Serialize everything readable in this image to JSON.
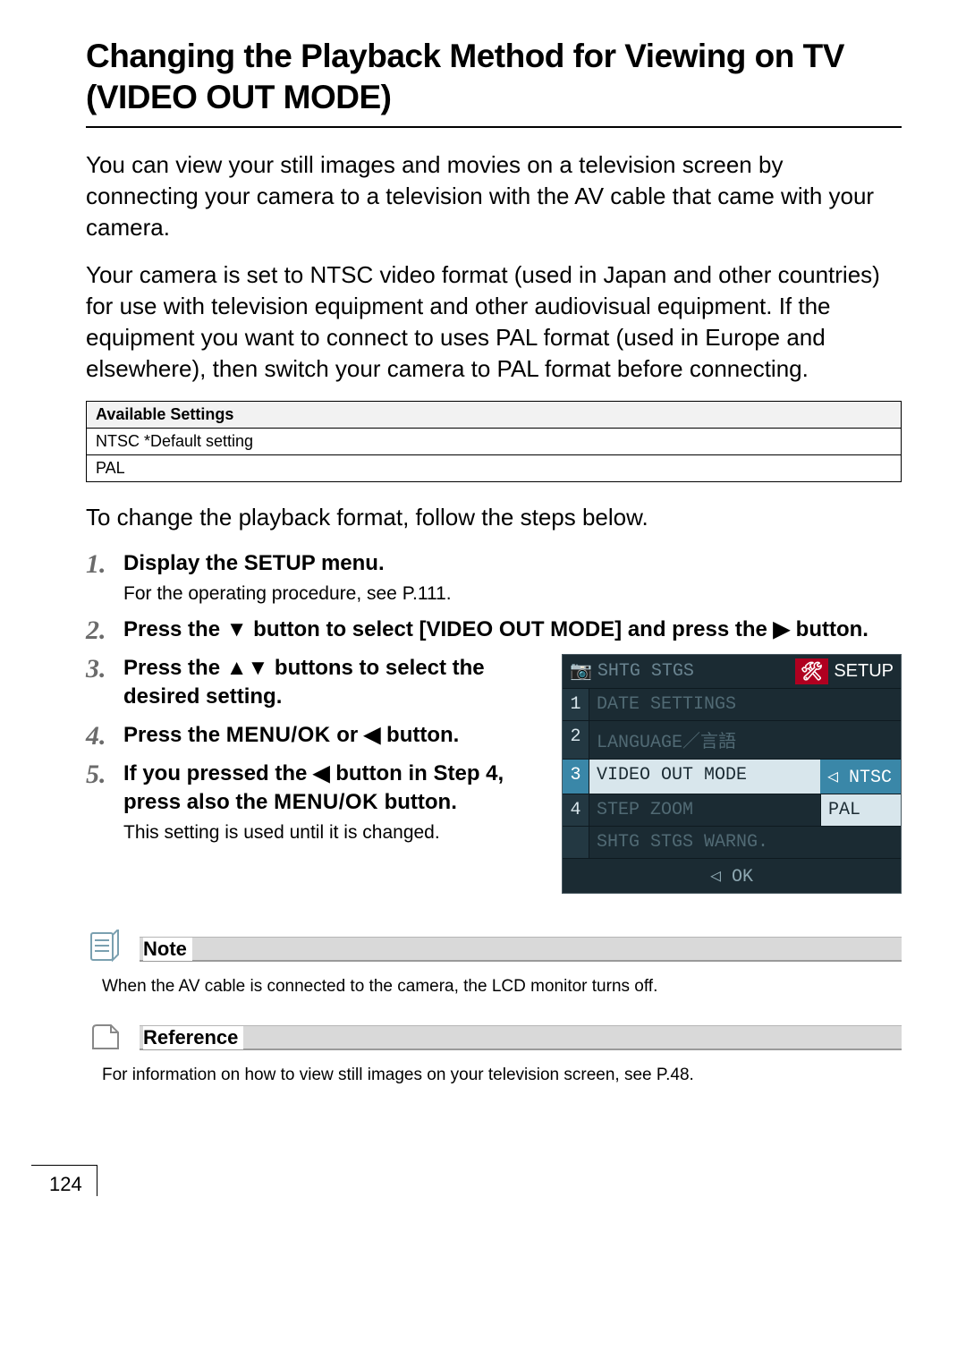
{
  "title": "Changing the Playback Method for Viewing on TV (VIDEO OUT MODE)",
  "intro_p1": "You can view your still images and movies on a television screen by connecting your camera to a television with the AV cable that came with your camera.",
  "intro_p2": "Your camera is set to NTSC video format (used in Japan and other countries) for use with television equipment and other audiovisual equipment. If the equipment you want to connect to uses PAL format (used in Europe and elsewhere), then switch your camera to PAL format before connecting.",
  "settings_table": {
    "header": "Available Settings",
    "rows": [
      "NTSC *Default setting",
      "PAL"
    ]
  },
  "lead": "To change the playback format, follow the steps below.",
  "steps": [
    {
      "num": "1.",
      "title": "Display the SETUP menu.",
      "sub": "For the operating procedure, see P.111."
    },
    {
      "num": "2.",
      "title_parts": [
        "Press the ",
        "▼",
        " button to select [VIDEO OUT MODE] and press the ",
        "▶",
        " button."
      ]
    },
    {
      "num": "3.",
      "title_parts": [
        "Press the ",
        "▲▼",
        " buttons to select the desired setting."
      ]
    },
    {
      "num": "4.",
      "title_parts": [
        "Press the ",
        "MENU/OK",
        " or ",
        "◀",
        " button."
      ]
    },
    {
      "num": "5.",
      "title_parts": [
        "If you pressed the ",
        "◀",
        " button in Step 4, press also the ",
        "MENU/OK",
        " button."
      ],
      "sub": "This setting is used until it is changed."
    }
  ],
  "camera_ui": {
    "tab_left": "SHTG STGS",
    "tab_setup_icon": "🛠",
    "tab_setup_label": "SETUP",
    "rows": [
      {
        "idx": "1",
        "label": "DATE SETTINGS"
      },
      {
        "idx": "2",
        "label": "LANGUAGE／言語"
      },
      {
        "idx": "3",
        "label": "VIDEO OUT MODE",
        "opt": "NTSC",
        "active": true
      },
      {
        "idx": "4",
        "label": "STEP ZOOM",
        "opt": "PAL",
        "opt_highlight": true
      },
      {
        "idx": "",
        "label": "SHTG STGS WARNG."
      }
    ],
    "footer": "◁ OK"
  },
  "note": {
    "label": "Note",
    "text": "When the AV cable is connected to the camera, the LCD monitor turns off."
  },
  "reference": {
    "label": "Reference",
    "text": "For information on how to view still images on your television screen, see P.48."
  },
  "page_number": "124"
}
